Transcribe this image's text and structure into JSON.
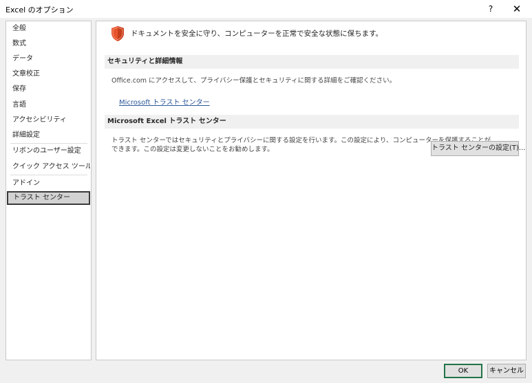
{
  "window": {
    "title": "Excel のオプション",
    "help": "?",
    "close": "✕"
  },
  "sidebar": {
    "items": [
      {
        "label": "全般"
      },
      {
        "label": "数式"
      },
      {
        "label": "データ"
      },
      {
        "label": "文章校正"
      },
      {
        "label": "保存"
      },
      {
        "label": "言語"
      },
      {
        "label": "アクセシビリティ"
      },
      {
        "label": "詳細設定"
      },
      {
        "label": "リボンのユーザー設定"
      },
      {
        "label": "クイック アクセス ツール バー"
      },
      {
        "label": "アドイン"
      },
      {
        "label": "トラスト センター"
      }
    ],
    "selected": "トラスト センター"
  },
  "main": {
    "intro": "ドキュメントを安全に守り、コンピューターを正常で安全な状態に保ちます。",
    "section1": {
      "header": "セキュリティと詳細情報",
      "text": "Office.com にアクセスして、プライバシー保護とセキュリティに関する詳細をご確認ください。",
      "link": "Microsoft トラスト センター"
    },
    "section2": {
      "header": "Microsoft Excel トラスト センター",
      "text_line1": "トラスト センターではセキュリティとプライバシーに関する設定を行います。この設定により、コンピューターを保護することが",
      "text_line2": "できます。この設定は変更しないことをお勧めします。",
      "button": "トラスト センターの設定(T)..."
    }
  },
  "footer": {
    "ok": "OK",
    "cancel": "キャンセル"
  },
  "colors": {
    "accent": "#217346",
    "shield": "#e8542c",
    "link": "#2b579a"
  }
}
